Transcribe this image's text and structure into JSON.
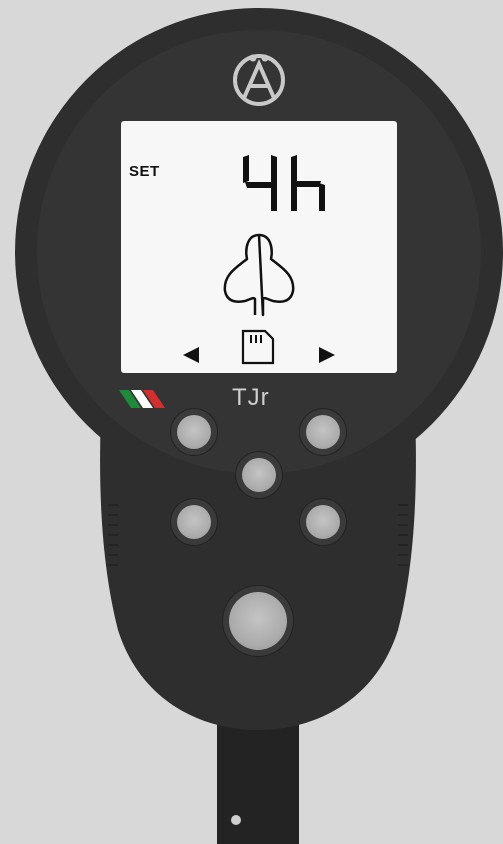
{
  "device": {
    "logo_icon": "brand-logo-icon",
    "brand_text": "TJr",
    "flag_colors": [
      "#1e8a3a",
      "#ffffff",
      "#d32f2f"
    ]
  },
  "screen": {
    "mode_label": "SET",
    "value_text": "4h",
    "saddle_icon": "saddle-icon",
    "storage_icon": "sd-card-icon",
    "left_arrow_icon": "arrow-left-icon",
    "right_arrow_icon": "arrow-right-icon"
  },
  "buttons": [
    {
      "name": "top-left-button"
    },
    {
      "name": "top-right-button"
    },
    {
      "name": "center-button"
    },
    {
      "name": "middle-left-button"
    },
    {
      "name": "middle-right-button"
    },
    {
      "name": "main-button"
    }
  ],
  "colors": {
    "body": "#2e2e2e",
    "screen": "#f7f7f7",
    "button": "#b2b2b2",
    "background": "#d8d8d8"
  }
}
